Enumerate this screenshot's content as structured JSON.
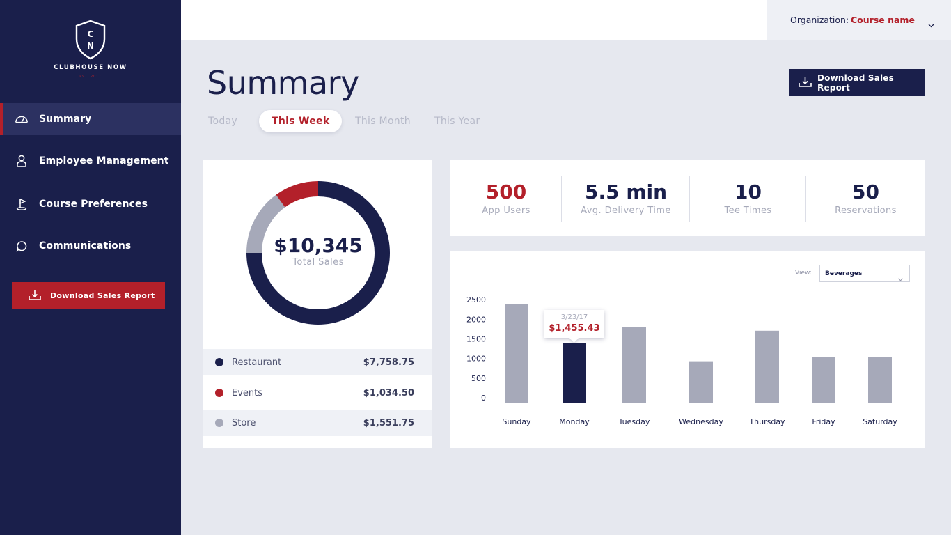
{
  "brand": {
    "logo_letters": [
      "C",
      "N"
    ],
    "name": "CLUBHOUSE NOW",
    "established": "EST. 2017",
    "navy": "#1a1f4b",
    "red": "#b3202a",
    "gray": "#a6a9b9"
  },
  "sidebar": {
    "items": [
      {
        "label": "Summary",
        "icon": "gauge-icon",
        "active": true
      },
      {
        "label": "Employee Management",
        "icon": "person-icon"
      },
      {
        "label": "Course Preferences",
        "icon": "golf-flag-icon"
      },
      {
        "label": "Communications",
        "icon": "chat-bubble-icon"
      }
    ],
    "download_label": "Download Sales Report"
  },
  "topbar": {
    "org_label": "Organization:",
    "org_value": "Course name"
  },
  "main": {
    "title": "Summary",
    "download_label": "Download Sales Report",
    "tabs": [
      {
        "label": "Today"
      },
      {
        "label": "This Week",
        "active": true
      },
      {
        "label": "This Month"
      },
      {
        "label": "This Year"
      }
    ]
  },
  "sales": {
    "total": "$10,345",
    "total_label": "Total Sales",
    "legend": [
      {
        "name": "Restaurant",
        "value": "$7,758.75",
        "color": "#1a1f4b"
      },
      {
        "name": "Events",
        "value": "$1,034.50",
        "color": "#b3202a"
      },
      {
        "name": "Store",
        "value": "$1,551.75",
        "color": "#a6a9b9"
      }
    ]
  },
  "stats": [
    {
      "value": "500",
      "label": "App Users",
      "highlight": true
    },
    {
      "value": "5.5 min",
      "label": "Avg. Delivery Time"
    },
    {
      "value": "10",
      "label": "Tee Times"
    },
    {
      "value": "50",
      "label": "Reservations"
    }
  ],
  "chart_controls": {
    "view_label": "View:",
    "view_value": "Beverages"
  },
  "tooltip": {
    "date": "3/23/17",
    "value": "$1,455.43"
  },
  "chart_data": [
    {
      "type": "pie",
      "labels": [
        "Restaurant",
        "Events",
        "Store"
      ],
      "values": [
        7758.75,
        1034.5,
        1551.75
      ],
      "colors": [
        "#1a1f4b",
        "#b3202a",
        "#a6a9b9"
      ]
    },
    {
      "type": "bar",
      "categories": [
        "Sunday",
        "Monday",
        "Tuesday",
        "Wednesday",
        "Thursday",
        "Friday",
        "Saturday"
      ],
      "values": [
        2400,
        1455.43,
        1850,
        1020,
        1760,
        1130,
        1130
      ],
      "highlight_index": 1,
      "yticks": [
        0,
        500,
        1000,
        1500,
        2000,
        2500
      ],
      "ylim": [
        0,
        2500
      ],
      "grid": false
    }
  ]
}
